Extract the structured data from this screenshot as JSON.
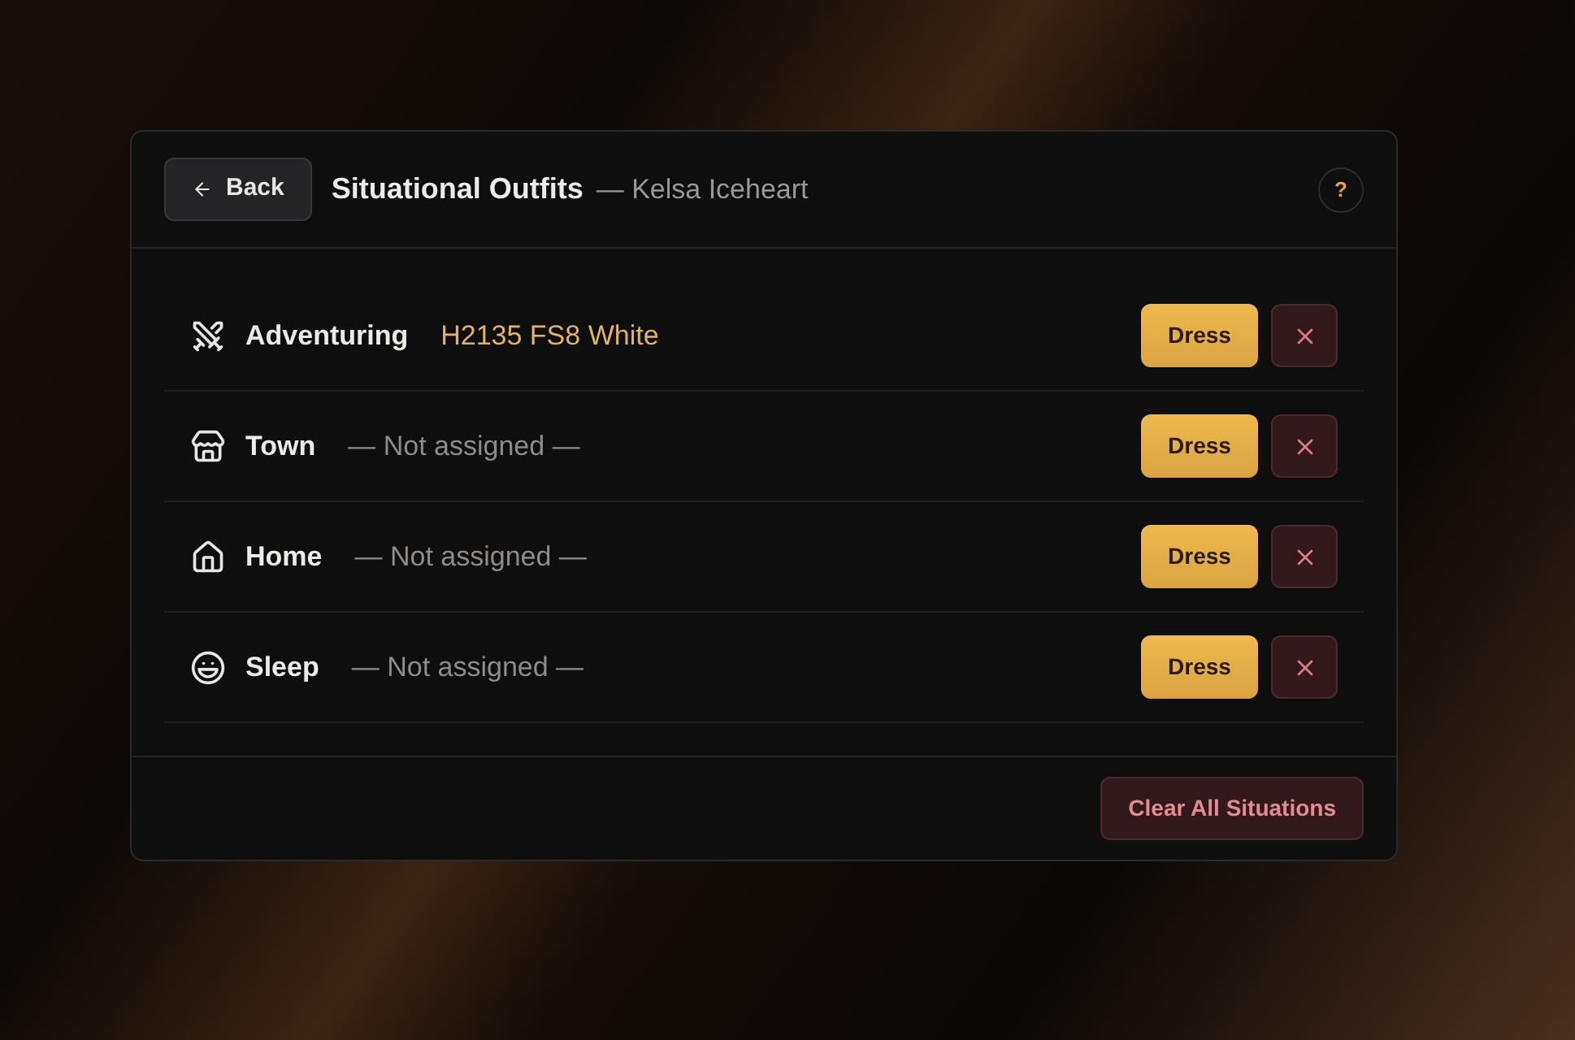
{
  "header": {
    "back": "Back",
    "title": "Situational Outfits",
    "subtitle": "— Kelsa Iceheart",
    "help": "?"
  },
  "situations": [
    {
      "name": "Adventuring",
      "outfit": "H2135 FS8 White",
      "assigned": true,
      "dress": "Dress"
    },
    {
      "name": "Town",
      "outfit": "— Not assigned —",
      "assigned": false,
      "dress": "Dress"
    },
    {
      "name": "Home",
      "outfit": "— Not assigned —",
      "assigned": false,
      "dress": "Dress"
    },
    {
      "name": "Sleep",
      "outfit": "— Not assigned —",
      "assigned": false,
      "dress": "Dress"
    }
  ],
  "footer": {
    "clear": "Clear All Situations"
  }
}
